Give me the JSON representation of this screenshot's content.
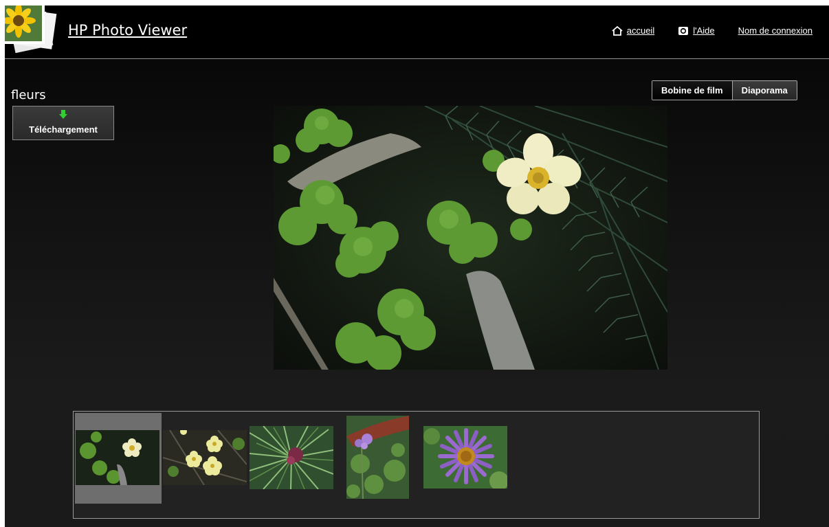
{
  "header": {
    "app_title": "HP Photo Viewer",
    "nav": {
      "home_label": "accueil",
      "help_label": "l'Aide",
      "login_label": "Nom de connexion"
    }
  },
  "album": {
    "title": "fleurs"
  },
  "toolbar": {
    "download_label": "Téléchargement",
    "download_arrow_color": "#33cc33"
  },
  "view_toggle": {
    "film_label": "Bobine de film",
    "slideshow_label": "Diaporama",
    "active": "Diaporama"
  },
  "filmstrip": {
    "selected_index": 0,
    "count": 5
  },
  "colors": {
    "background": "#000000",
    "panel": "#1c1c1c",
    "border": "#9a9a9a",
    "selected_thumb": "#6e6e6e"
  }
}
